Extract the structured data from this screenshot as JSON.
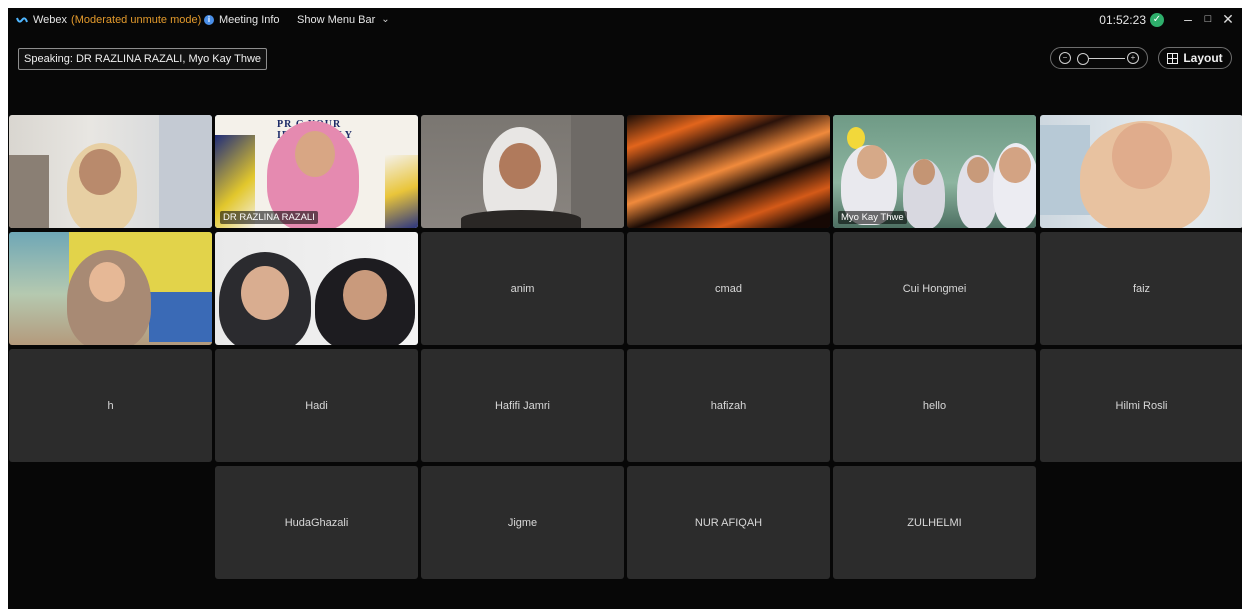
{
  "titlebar": {
    "app_name": "Webex",
    "mode": "(Moderated unmute mode)",
    "meeting_info": "Meeting Info",
    "show_menu_bar": "Show Menu Bar",
    "time": "01:52:23",
    "icons": [
      "webex-logo-icon",
      "info-icon",
      "chevron-down-icon",
      "connected-check-icon",
      "minimize-icon",
      "maximize-icon",
      "close-icon"
    ]
  },
  "speaking": "Speaking: DR RAZLINA RAZALI, Myo Kay Thwe",
  "toolbar": {
    "layout_label": "Layout",
    "zoom_icons": [
      "zoom-out-icon",
      "zoom-in-icon"
    ]
  },
  "video_tiles": [
    {
      "id": "video-1",
      "label": ""
    },
    {
      "id": "video-2",
      "label": "DR RAZLINA RAZALI",
      "poster_line1": "PR      G YOUR",
      "poster_line2": "IDE      CTIVELY"
    },
    {
      "id": "video-3",
      "label": ""
    },
    {
      "id": "video-4",
      "label": ""
    },
    {
      "id": "video-5",
      "label": "Myo Kay Thwe"
    },
    {
      "id": "video-6",
      "label": ""
    },
    {
      "id": "video-7",
      "label": ""
    },
    {
      "id": "video-8",
      "label": ""
    }
  ],
  "participants": [
    {
      "name": "anim"
    },
    {
      "name": "cmad"
    },
    {
      "name": "Cui Hongmei"
    },
    {
      "name": "faiz"
    },
    {
      "name": "h"
    },
    {
      "name": "Hadi"
    },
    {
      "name": "Hafifi Jamri"
    },
    {
      "name": "hafizah"
    },
    {
      "name": "hello"
    },
    {
      "name": "Hilmi Rosli"
    },
    {
      "name": "HudaGhazali"
    },
    {
      "name": "Jigme"
    },
    {
      "name": "NUR AFIQAH"
    },
    {
      "name": "ZULHELMI"
    }
  ],
  "colors": {
    "background": "#070707",
    "tile": "#2c2c2c",
    "mode_text": "#e39a2c",
    "active_border": "#8fb8e8"
  }
}
